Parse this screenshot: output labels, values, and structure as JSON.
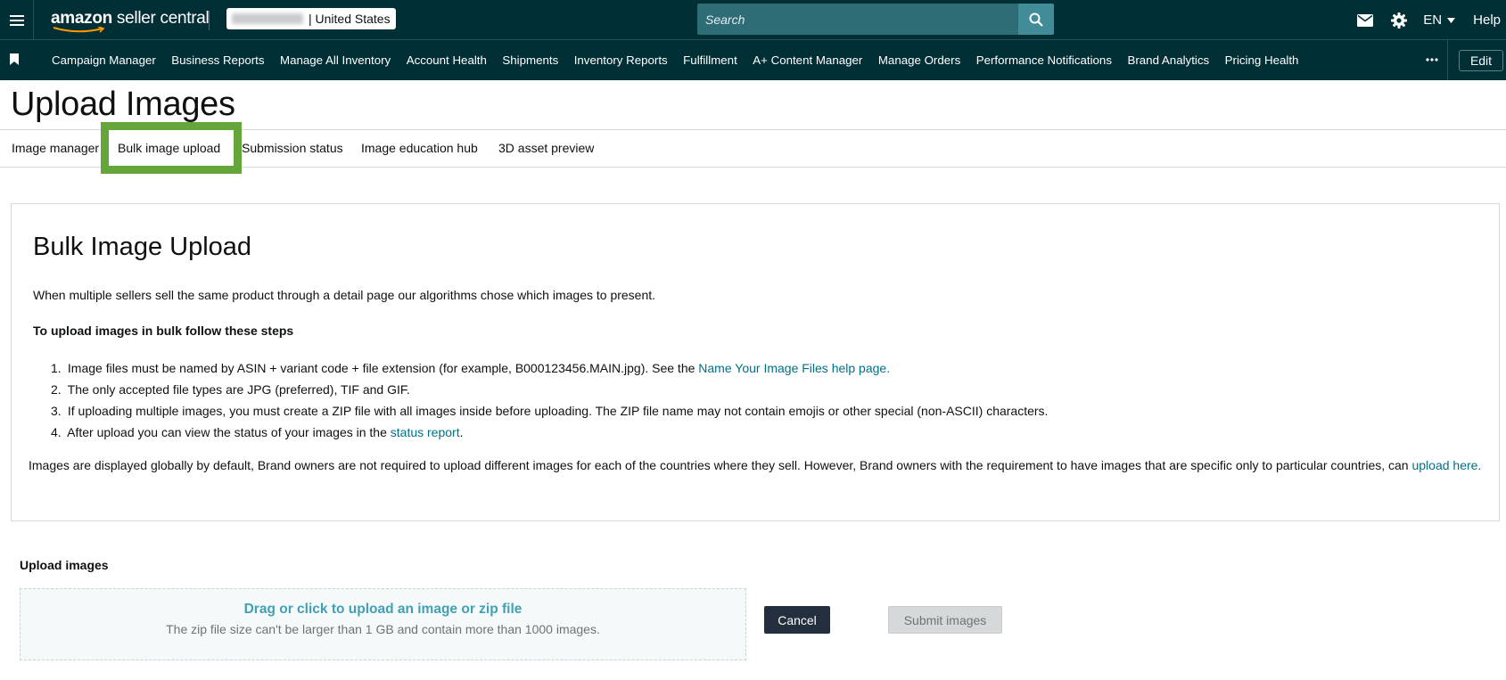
{
  "header": {
    "logo_text_bold": "amazon",
    "logo_text_rest": " seller central",
    "account_suffix": "| United States",
    "search_placeholder": "Search",
    "language": "EN",
    "help_label": "Help",
    "icons": [
      "menu-icon",
      "mail-icon",
      "gear-icon",
      "search-icon",
      "caret-down-icon"
    ]
  },
  "nav": {
    "items": [
      "Campaign Manager",
      "Business Reports",
      "Manage All Inventory",
      "Account Health",
      "Shipments",
      "Inventory Reports",
      "Fulfillment",
      "A+ Content Manager",
      "Manage Orders",
      "Performance Notifications",
      "Brand Analytics",
      "Pricing Health"
    ],
    "edit_label": "Edit"
  },
  "page": {
    "title": "Upload Images",
    "tabs": [
      "Image manager",
      "Bulk image upload",
      "Submission status",
      "Image education hub",
      "3D asset preview"
    ],
    "active_tab": "Bulk image upload"
  },
  "card": {
    "title": "Bulk Image Upload",
    "intro": "When multiple sellers sell the same product through a detail page our algorithms chose which images to present.",
    "steps_heading": "To upload images in bulk follow these steps",
    "steps": [
      {
        "num": "1.",
        "text": "Image files must be named by ASIN + variant code + file extension (for example, B000123456.MAIN.jpg). See the ",
        "link": "Name Your Image Files help page.",
        "after": ""
      },
      {
        "num": "2.",
        "text": "The only accepted file types are JPG (preferred), TIF and GIF.",
        "link": "",
        "after": ""
      },
      {
        "num": "3.",
        "text": "If uploading multiple images, you must create a ZIP file with all images inside before uploading. The ZIP file name may not contain emojis or other special (non-ASCII) characters.",
        "link": "",
        "after": ""
      },
      {
        "num": "4.",
        "text": "After upload you can view the status of your images in the ",
        "link": "status report",
        "after": "."
      }
    ],
    "note": "Images are displayed globally by default, Brand owners are not required to upload different images for each of the countries where they sell. However, Brand owners with the requirement to have images that are specific only to particular countries, can ",
    "note_link": "upload here."
  },
  "upload": {
    "label": "Upload images",
    "drop_main": "Drag or click to upload an image or zip file",
    "drop_sub": "The zip file size can't be larger than 1 GB and contain more than 1000 images.",
    "cancel_label": "Cancel",
    "submit_label": "Submit images",
    "submit_disabled": true
  },
  "colors": {
    "header_bg": "#002f36",
    "search_bg": "#2e6c76",
    "search_btn": "#418c98",
    "link": "#007185",
    "highlight_box": "#64a63a",
    "drop_text": "#42a0b3",
    "cancel_bg": "#232f3e"
  }
}
